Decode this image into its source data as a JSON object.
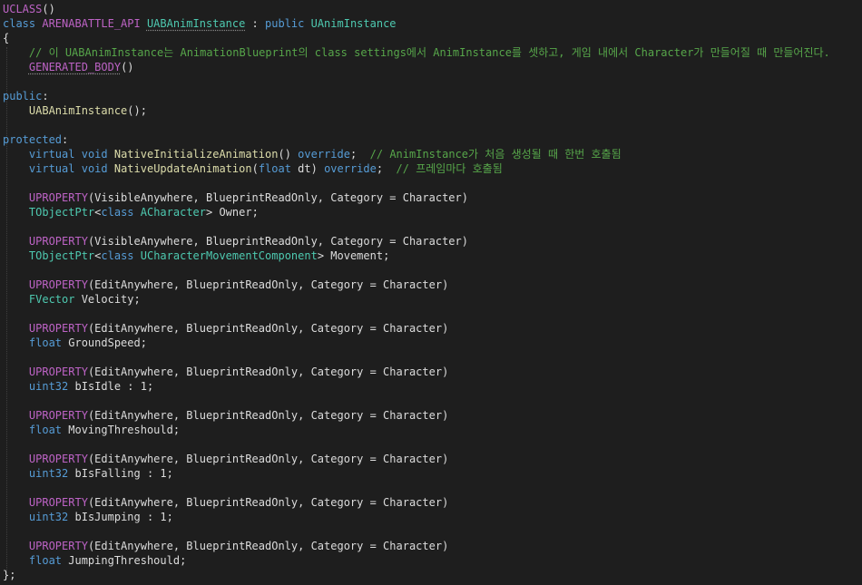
{
  "theme": {
    "background": "#1e1e1e",
    "colors": {
      "macro": "#bd63c5",
      "keyword": "#569cd6",
      "type": "#4ec9b0",
      "function": "#dcdcaa",
      "comment": "#57a64a",
      "plain": "#dcdcdc"
    }
  },
  "code_lines": [
    [
      {
        "t": "UCLASS",
        "k": "macro"
      },
      {
        "t": "()",
        "k": "plain"
      }
    ],
    [
      {
        "t": "class",
        "k": "keyword"
      },
      {
        "t": " ARENABATTLE_API ",
        "k": "macro"
      },
      {
        "t": "UABAnimInstance",
        "k": "type",
        "sq": true
      },
      {
        "t": " : ",
        "k": "plain"
      },
      {
        "t": "public",
        "k": "keyword"
      },
      {
        "t": " ",
        "k": "plain"
      },
      {
        "t": "UAnimInstance",
        "k": "type"
      }
    ],
    [
      {
        "t": "{",
        "k": "plain"
      }
    ],
    [
      {
        "t": "    // 이 UABAnimInstance는 AnimationBlueprint의 class settings에서 AnimInstance를 셋하고, 게임 내에서 Character가 만들어질 때 만들어진다.",
        "k": "comment"
      }
    ],
    [
      {
        "t": "    ",
        "k": "plain"
      },
      {
        "t": "GENERATED_BODY",
        "k": "macro",
        "sq": true
      },
      {
        "t": "()",
        "k": "plain"
      }
    ],
    [],
    [
      {
        "t": "public",
        "k": "keyword"
      },
      {
        "t": ":",
        "k": "plain"
      }
    ],
    [
      {
        "t": "    ",
        "k": "plain"
      },
      {
        "t": "UABAnimInstance",
        "k": "func"
      },
      {
        "t": "();",
        "k": "plain"
      }
    ],
    [],
    [
      {
        "t": "protected",
        "k": "keyword"
      },
      {
        "t": ":",
        "k": "plain"
      }
    ],
    [
      {
        "t": "    ",
        "k": "plain"
      },
      {
        "t": "virtual",
        "k": "keyword"
      },
      {
        "t": " ",
        "k": "plain"
      },
      {
        "t": "void",
        "k": "keyword"
      },
      {
        "t": " ",
        "k": "plain"
      },
      {
        "t": "NativeInitializeAnimation",
        "k": "func"
      },
      {
        "t": "() ",
        "k": "plain"
      },
      {
        "t": "override",
        "k": "keyword"
      },
      {
        "t": ";  ",
        "k": "plain"
      },
      {
        "t": "// AnimInstance가 처음 생성될 때 한번 호출됨",
        "k": "comment"
      }
    ],
    [
      {
        "t": "    ",
        "k": "plain"
      },
      {
        "t": "virtual",
        "k": "keyword"
      },
      {
        "t": " ",
        "k": "plain"
      },
      {
        "t": "void",
        "k": "keyword"
      },
      {
        "t": " ",
        "k": "plain"
      },
      {
        "t": "NativeUpdateAnimation",
        "k": "func"
      },
      {
        "t": "(",
        "k": "plain"
      },
      {
        "t": "float",
        "k": "keyword"
      },
      {
        "t": " dt) ",
        "k": "plain"
      },
      {
        "t": "override",
        "k": "keyword"
      },
      {
        "t": ";  ",
        "k": "plain"
      },
      {
        "t": "// 프레임마다 호출됨",
        "k": "comment"
      }
    ],
    [],
    [
      {
        "t": "    ",
        "k": "plain"
      },
      {
        "t": "UPROPERTY",
        "k": "macro"
      },
      {
        "t": "(VisibleAnywhere, BlueprintReadOnly, Category = Character)",
        "k": "plain"
      }
    ],
    [
      {
        "t": "    ",
        "k": "plain"
      },
      {
        "t": "TObjectPtr",
        "k": "type"
      },
      {
        "t": "<",
        "k": "plain"
      },
      {
        "t": "class",
        "k": "keyword"
      },
      {
        "t": " ",
        "k": "plain"
      },
      {
        "t": "ACharacter",
        "k": "type"
      },
      {
        "t": "> Owner;",
        "k": "plain"
      }
    ],
    [],
    [
      {
        "t": "    ",
        "k": "plain"
      },
      {
        "t": "UPROPERTY",
        "k": "macro"
      },
      {
        "t": "(VisibleAnywhere, BlueprintReadOnly, Category = Character)",
        "k": "plain"
      }
    ],
    [
      {
        "t": "    ",
        "k": "plain"
      },
      {
        "t": "TObjectPtr",
        "k": "type"
      },
      {
        "t": "<",
        "k": "plain"
      },
      {
        "t": "class",
        "k": "keyword"
      },
      {
        "t": " ",
        "k": "plain"
      },
      {
        "t": "UCharacterMovementComponent",
        "k": "type"
      },
      {
        "t": "> Movement;",
        "k": "plain"
      }
    ],
    [],
    [
      {
        "t": "    ",
        "k": "plain"
      },
      {
        "t": "UPROPERTY",
        "k": "macro"
      },
      {
        "t": "(EditAnywhere, BlueprintReadOnly, Category = Character)",
        "k": "plain"
      }
    ],
    [
      {
        "t": "    ",
        "k": "plain"
      },
      {
        "t": "FVector",
        "k": "type"
      },
      {
        "t": " Velocity;",
        "k": "plain"
      }
    ],
    [],
    [
      {
        "t": "    ",
        "k": "plain"
      },
      {
        "t": "UPROPERTY",
        "k": "macro"
      },
      {
        "t": "(EditAnywhere, BlueprintReadOnly, Category = Character)",
        "k": "plain"
      }
    ],
    [
      {
        "t": "    ",
        "k": "plain"
      },
      {
        "t": "float",
        "k": "keyword"
      },
      {
        "t": " GroundSpeed;",
        "k": "plain"
      }
    ],
    [],
    [
      {
        "t": "    ",
        "k": "plain"
      },
      {
        "t": "UPROPERTY",
        "k": "macro"
      },
      {
        "t": "(EditAnywhere, BlueprintReadOnly, Category = Character)",
        "k": "plain"
      }
    ],
    [
      {
        "t": "    ",
        "k": "plain"
      },
      {
        "t": "uint32",
        "k": "keyword"
      },
      {
        "t": " bIsIdle : 1;",
        "k": "plain"
      }
    ],
    [],
    [
      {
        "t": "    ",
        "k": "plain"
      },
      {
        "t": "UPROPERTY",
        "k": "macro"
      },
      {
        "t": "(EditAnywhere, BlueprintReadOnly, Category = Character)",
        "k": "plain"
      }
    ],
    [
      {
        "t": "    ",
        "k": "plain"
      },
      {
        "t": "float",
        "k": "keyword"
      },
      {
        "t": " MovingThreshould;",
        "k": "plain"
      }
    ],
    [],
    [
      {
        "t": "    ",
        "k": "plain"
      },
      {
        "t": "UPROPERTY",
        "k": "macro"
      },
      {
        "t": "(EditAnywhere, BlueprintReadOnly, Category = Character)",
        "k": "plain"
      }
    ],
    [
      {
        "t": "    ",
        "k": "plain"
      },
      {
        "t": "uint32",
        "k": "keyword"
      },
      {
        "t": " bIsFalling : 1;",
        "k": "plain"
      }
    ],
    [],
    [
      {
        "t": "    ",
        "k": "plain"
      },
      {
        "t": "UPROPERTY",
        "k": "macro"
      },
      {
        "t": "(EditAnywhere, BlueprintReadOnly, Category = Character)",
        "k": "plain"
      }
    ],
    [
      {
        "t": "    ",
        "k": "plain"
      },
      {
        "t": "uint32",
        "k": "keyword"
      },
      {
        "t": " bIsJumping : 1;",
        "k": "plain"
      }
    ],
    [],
    [
      {
        "t": "    ",
        "k": "plain"
      },
      {
        "t": "UPROPERTY",
        "k": "macro"
      },
      {
        "t": "(EditAnywhere, BlueprintReadOnly, Category = Character)",
        "k": "plain"
      }
    ],
    [
      {
        "t": "    ",
        "k": "plain"
      },
      {
        "t": "float",
        "k": "keyword"
      },
      {
        "t": " JumpingThreshould;",
        "k": "plain"
      }
    ],
    [
      {
        "t": "};",
        "k": "plain"
      }
    ]
  ]
}
